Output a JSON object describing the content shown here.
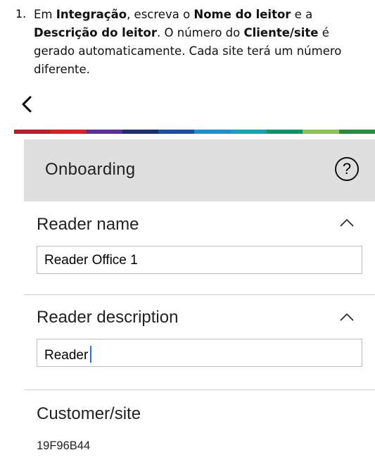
{
  "instruction": {
    "number": "1.",
    "parts": [
      {
        "text": "Em ",
        "bold": false
      },
      {
        "text": "Integração",
        "bold": true
      },
      {
        "text": ", escreva o ",
        "bold": false
      },
      {
        "text": "Nome do leitor",
        "bold": true
      },
      {
        "text": " e a ",
        "bold": false
      },
      {
        "text": "Descrição do leitor",
        "bold": true
      },
      {
        "text": ". O número do ",
        "bold": false
      },
      {
        "text": "Cliente/site",
        "bold": true
      },
      {
        "text": " é gerado automaticamente. Cada site terá um número diferente.",
        "bold": false
      }
    ]
  },
  "nav": {
    "back_icon": "chevron-left-icon"
  },
  "brand_colors": [
    "#b51f2a",
    "#d71f26",
    "#5d2f8e",
    "#1f2b74",
    "#1d4fa0",
    "#1b8fc6",
    "#13a3b5",
    "#10936a",
    "#8cc15b",
    "#2c8a3d"
  ],
  "header": {
    "title": "Onboarding",
    "help_icon": "?"
  },
  "reader_name": {
    "label": "Reader name",
    "value": "Reader Office 1"
  },
  "reader_description": {
    "label": "Reader description",
    "value": "Reader"
  },
  "customer_site": {
    "label": "Customer/site",
    "value": "19F96B44"
  }
}
